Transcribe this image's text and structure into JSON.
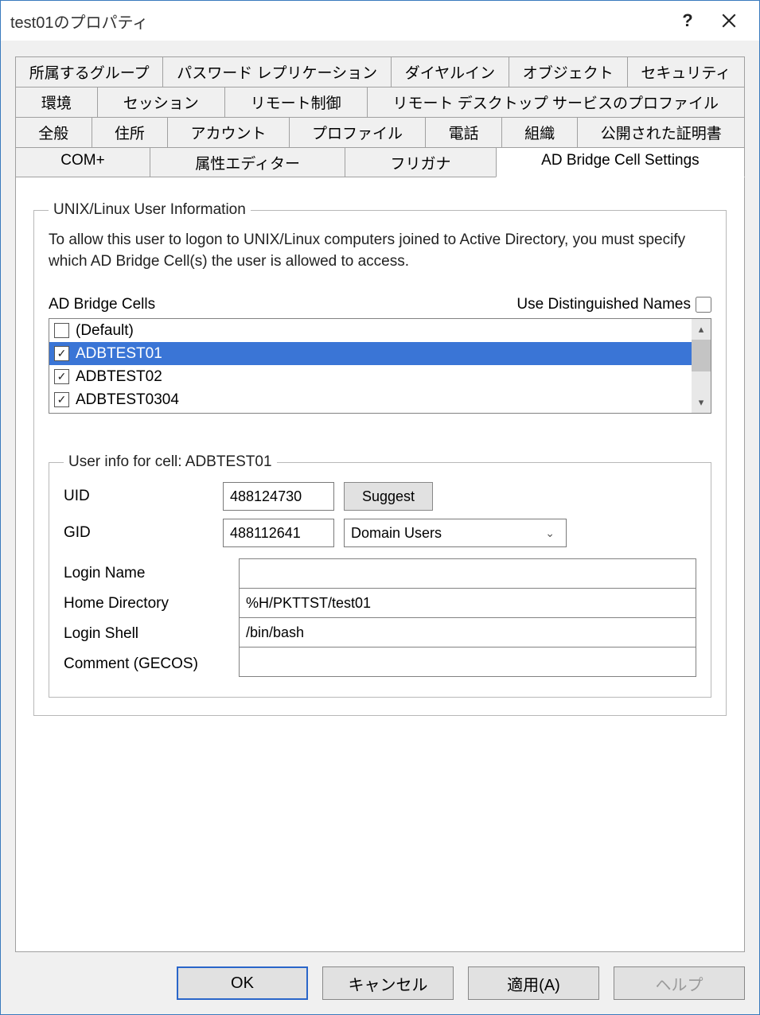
{
  "window": {
    "title": "test01のプロパティ"
  },
  "tabs": {
    "row1": [
      "所属するグループ",
      "パスワード レプリケーション",
      "ダイヤルイン",
      "オブジェクト",
      "セキュリティ"
    ],
    "row2": [
      "環境",
      "セッション",
      "リモート制御",
      "リモート デスクトップ サービスのプロファイル"
    ],
    "row3": [
      "全般",
      "住所",
      "アカウント",
      "プロファイル",
      "電話",
      "組織",
      "公開された証明書"
    ],
    "row4": [
      "COM+",
      "属性エディター",
      "フリガナ",
      "AD Bridge Cell Settings"
    ],
    "active": "AD Bridge Cell Settings"
  },
  "group1": {
    "legend": "UNIX/Linux User Information",
    "desc": "To allow this user to logon to UNIX/Linux computers joined to Active Directory, you must specify which AD Bridge Cell(s) the user is allowed to access.",
    "cells_label": "AD Bridge Cells",
    "dn_label": "Use Distinguished Names",
    "dn_checked": false,
    "items": [
      {
        "label": "(Default)",
        "checked": false,
        "selected": false
      },
      {
        "label": "ADBTEST01",
        "checked": true,
        "selected": true
      },
      {
        "label": "ADBTEST02",
        "checked": true,
        "selected": false
      },
      {
        "label": "ADBTEST0304",
        "checked": true,
        "selected": false
      }
    ]
  },
  "group2": {
    "legend": "User info for cell: ADBTEST01",
    "uid_label": "UID",
    "uid_value": "488124730",
    "suggest_label": "Suggest",
    "gid_label": "GID",
    "gid_value": "488112641",
    "gid_group": "Domain Users",
    "login_name_label": "Login Name",
    "login_name_value": "",
    "home_dir_label": "Home Directory",
    "home_dir_value": "%H/PKTTST/test01",
    "login_shell_label": "Login Shell",
    "login_shell_value": "/bin/bash",
    "gecos_label": "Comment (GECOS)",
    "gecos_value": ""
  },
  "buttons": {
    "ok": "OK",
    "cancel": "キャンセル",
    "apply": "適用(A)",
    "help": "ヘルプ"
  }
}
